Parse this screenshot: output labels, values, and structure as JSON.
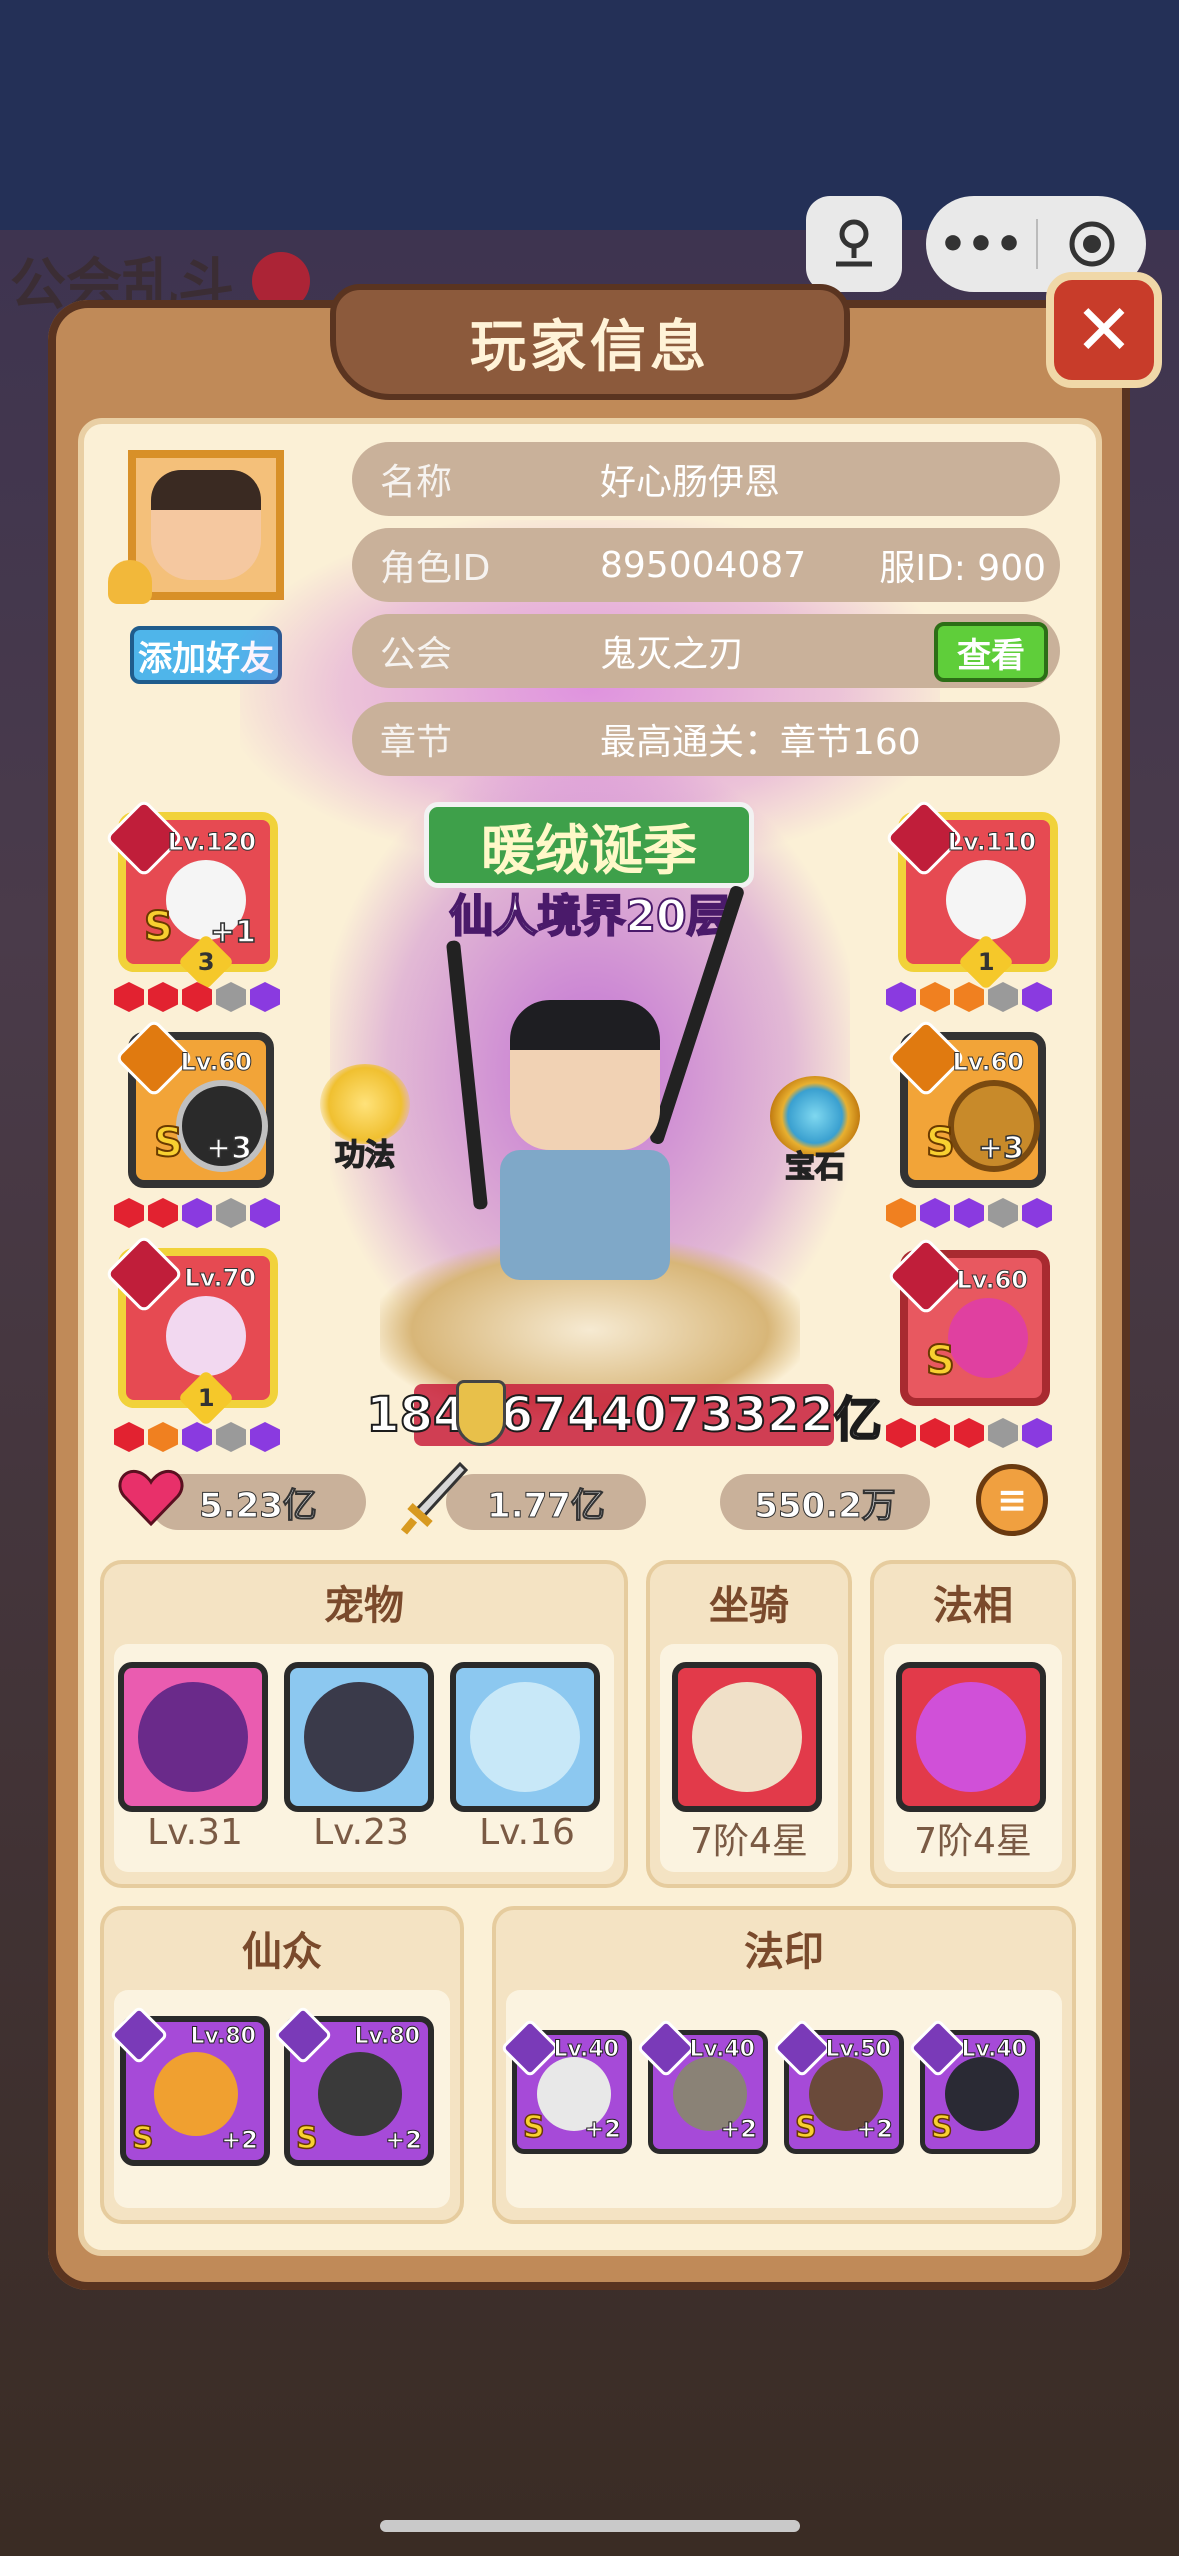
{
  "background": {
    "left_title": "公会乱斗"
  },
  "system": {
    "more_label": "•••"
  },
  "panel": {
    "title": "玩家信息",
    "close_label": "✕"
  },
  "player": {
    "add_friend_label": "添加好友",
    "rows": [
      {
        "label": "名称",
        "value": "好心肠伊恩"
      },
      {
        "label": "角色ID",
        "value": "895004087",
        "extra": "服ID: 900"
      },
      {
        "label": "公会",
        "value": "鬼灭之刃"
      },
      {
        "label": "章节",
        "value": "最高通关：章节160"
      }
    ],
    "view_label": "查看"
  },
  "hero": {
    "event_label": "暖绒诞季",
    "realm": "仙人境界20层",
    "power": "18446744073322",
    "power_unit": "亿",
    "skill_left": "功法",
    "skill_right": "宝石"
  },
  "equipment": {
    "left": [
      {
        "lv": "Lv.120",
        "plus": "+1",
        "star": "3",
        "gems": [
          "red",
          "red",
          "red",
          "grey",
          "purple"
        ]
      },
      {
        "lv": "Lv.60",
        "plus": "+3",
        "star": "",
        "gems": [
          "red",
          "red",
          "purple",
          "grey",
          "purple"
        ]
      },
      {
        "lv": "Lv.70",
        "plus": "",
        "star": "1",
        "gems": [
          "red",
          "orange",
          "purple",
          "grey",
          "purple"
        ]
      }
    ],
    "right": [
      {
        "lv": "Lv.110",
        "plus": "",
        "star": "1",
        "gems": [
          "purple",
          "orange",
          "orange",
          "grey",
          "purple"
        ]
      },
      {
        "lv": "Lv.60",
        "plus": "+3",
        "star": "",
        "gems": [
          "orange",
          "purple",
          "purple",
          "grey",
          "purple"
        ]
      },
      {
        "lv": "Lv.60",
        "plus": "",
        "star": "",
        "gems": [
          "red",
          "red",
          "red",
          "grey",
          "purple"
        ]
      }
    ],
    "grade": "S"
  },
  "stats": {
    "hp": "5.23亿",
    "atk": "1.77亿",
    "def": "550.2万"
  },
  "sections": {
    "pets": {
      "title": "宠物",
      "items": [
        "Lv.31",
        "Lv.23",
        "Lv.16"
      ]
    },
    "mount": {
      "title": "坐骑",
      "label": "7阶4星"
    },
    "avatar": {
      "title": "法相",
      "label": "7阶4星"
    },
    "immortals": {
      "title": "仙众",
      "items": [
        {
          "lv": "Lv.80",
          "plus": "+2"
        },
        {
          "lv": "Lv.80",
          "plus": "+2"
        }
      ]
    },
    "seals": {
      "title": "法印",
      "items": [
        {
          "lv": "Lv.40",
          "plus": "+2"
        },
        {
          "lv": "Lv.40",
          "plus": "+2"
        },
        {
          "lv": "Lv.50",
          "plus": "+2"
        },
        {
          "lv": "Lv.40",
          "plus": ""
        }
      ]
    }
  }
}
